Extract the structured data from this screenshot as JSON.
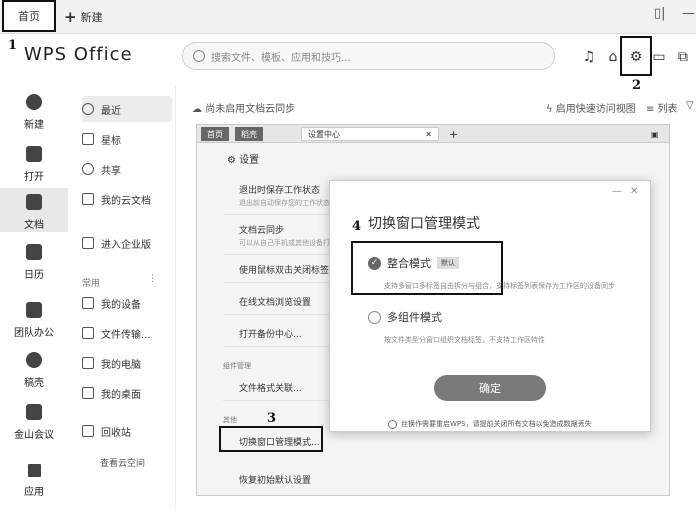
{
  "titlebar": {
    "home_tab": "首页",
    "new_tab": "新建"
  },
  "markers": {
    "m1": "1",
    "m2": "2",
    "m3": "3",
    "m4": "4"
  },
  "header": {
    "logo": "WPS Office",
    "search_placeholder": "搜索文件、模板、应用和技巧..."
  },
  "left_nav": [
    {
      "label": "新建",
      "icon": "plus-icon"
    },
    {
      "label": "打开",
      "icon": "folder-icon"
    },
    {
      "label": "文档",
      "icon": "document-icon"
    },
    {
      "label": "日历",
      "icon": "calendar-icon"
    },
    {
      "label": "团队办公",
      "icon": "team-icon"
    },
    {
      "label": "稿壳",
      "icon": "doc-shell-icon"
    },
    {
      "label": "金山会议",
      "icon": "video-icon"
    },
    {
      "label": "应用",
      "icon": "apps-icon"
    }
  ],
  "sidebar": {
    "items": [
      "最近",
      "星标",
      "共享",
      "我的云文档",
      "进入企业版"
    ],
    "section": "常用",
    "section_items": [
      "我的设备",
      "文件传输...",
      "我的电脑",
      "我的桌面"
    ],
    "recycle": "回收站",
    "cloud_space": "查看云空间"
  },
  "subheader": {
    "cloud_sync": "尚未启用文档云同步",
    "quick_access": "启用快速访问视图",
    "list": "列表"
  },
  "inner": {
    "tabs": [
      "首页",
      "稻壳",
      "设置中心"
    ],
    "settings_title": "设置",
    "rows": [
      {
        "title": "退出时保存工作状态",
        "desc": "退出前自动保存您的工作状态"
      },
      {
        "title": "文档云同步",
        "desc": "可以从自己手机或其他设备打开文档"
      },
      {
        "title": "使用鼠标双击关闭标签",
        "desc": ""
      },
      {
        "title": "在线文档浏览设置",
        "desc": ""
      },
      {
        "title": "打开备份中心...",
        "desc": ""
      }
    ],
    "group_components": "组件管理",
    "file_assoc": "文件格式关联...",
    "group_other": "其他",
    "switch_window": "切换窗口管理模式...",
    "restore_defaults": "恢复初始默认设置"
  },
  "dialog": {
    "title": "切换窗口管理模式",
    "opt1": "整合模式",
    "opt1_badge": "默认",
    "opt1_desc": "支持多窗口多标签自由拆分与组合，支持标签列表保存为工作区的设备同步",
    "opt2": "多组件模式",
    "opt2_desc": "按文件类型分窗口组织文档标签，不支持工作区特性",
    "confirm": "确定",
    "tip": "丝换作需要重启WPS，请提前关闭所有文档以免造成数据丢失"
  }
}
